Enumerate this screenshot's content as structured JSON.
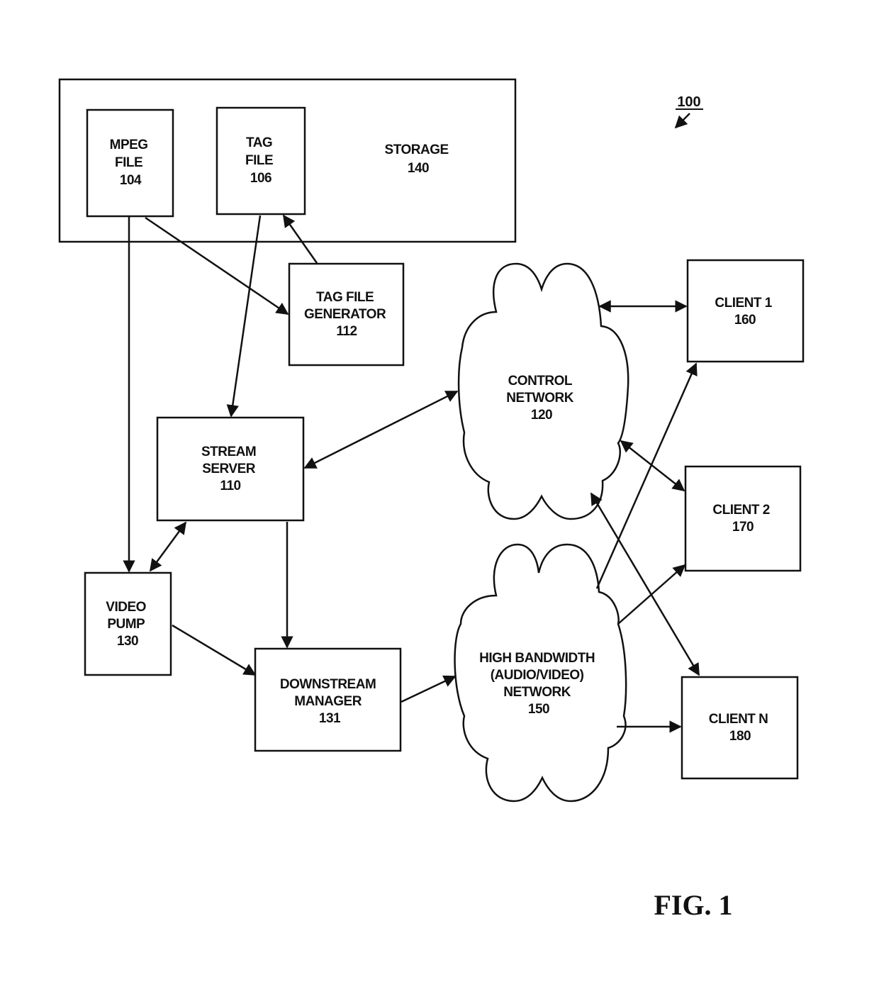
{
  "figure": {
    "label": "FIG. 1",
    "reference": "100"
  },
  "nodes": {
    "storage": {
      "lines": [
        "STORAGE",
        "140"
      ]
    },
    "mpeg_file": {
      "lines": [
        "MPEG",
        "FILE",
        "104"
      ]
    },
    "tag_file": {
      "lines": [
        "TAG",
        "FILE",
        "106"
      ]
    },
    "tag_file_generator": {
      "lines": [
        "TAG FILE",
        "GENERATOR",
        "112"
      ]
    },
    "stream_server": {
      "lines": [
        "STREAM",
        "SERVER",
        "110"
      ]
    },
    "video_pump": {
      "lines": [
        "VIDEO",
        "PUMP",
        "130"
      ]
    },
    "downstream_manager": {
      "lines": [
        "DOWNSTREAM",
        "MANAGER",
        "131"
      ]
    },
    "control_network": {
      "lines": [
        "CONTROL",
        "NETWORK",
        "120"
      ]
    },
    "high_bandwidth_network": {
      "lines": [
        "HIGH BANDWIDTH",
        "(AUDIO/VIDEO)",
        "NETWORK",
        "150"
      ]
    },
    "client_1": {
      "lines": [
        "CLIENT 1",
        "160"
      ]
    },
    "client_2": {
      "lines": [
        "CLIENT 2",
        "170"
      ]
    },
    "client_n": {
      "lines": [
        "CLIENT N",
        "180"
      ]
    }
  },
  "edges": [
    {
      "from": "mpeg_file",
      "to": "video_pump",
      "direction": "forward"
    },
    {
      "from": "mpeg_file",
      "to": "tag_file_generator",
      "direction": "forward"
    },
    {
      "from": "tag_file_generator",
      "to": "tag_file",
      "direction": "forward"
    },
    {
      "from": "tag_file",
      "to": "stream_server",
      "direction": "forward"
    },
    {
      "from": "stream_server",
      "to": "control_network",
      "direction": "both"
    },
    {
      "from": "stream_server",
      "to": "video_pump",
      "direction": "both"
    },
    {
      "from": "stream_server",
      "to": "downstream_manager",
      "direction": "forward"
    },
    {
      "from": "video_pump",
      "to": "downstream_manager",
      "direction": "forward"
    },
    {
      "from": "downstream_manager",
      "to": "high_bandwidth_network",
      "direction": "forward"
    },
    {
      "from": "control_network",
      "to": "client_1",
      "direction": "both"
    },
    {
      "from": "control_network",
      "to": "client_2",
      "direction": "both"
    },
    {
      "from": "control_network",
      "to": "client_n",
      "direction": "both"
    },
    {
      "from": "high_bandwidth_network",
      "to": "client_1",
      "direction": "forward"
    },
    {
      "from": "high_bandwidth_network",
      "to": "client_2",
      "direction": "forward"
    },
    {
      "from": "high_bandwidth_network",
      "to": "client_n",
      "direction": "forward"
    }
  ]
}
